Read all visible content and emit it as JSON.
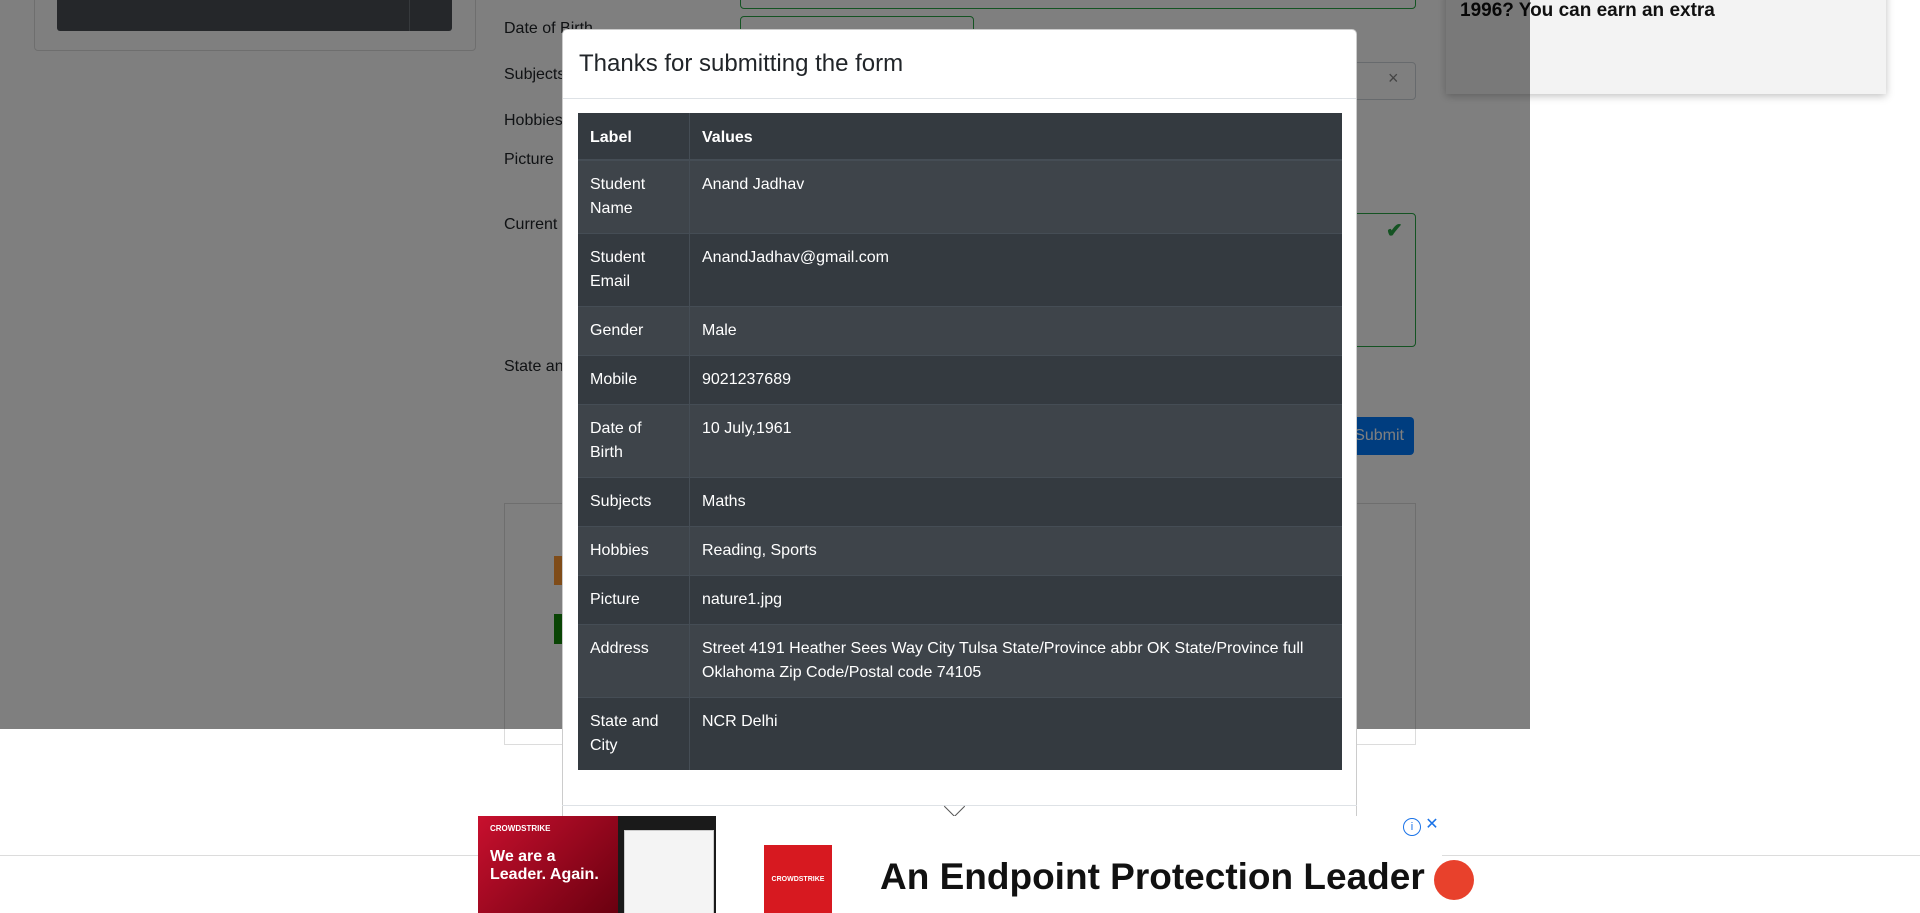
{
  "background_form": {
    "labels": {
      "date_of_birth": "Date of Birth",
      "subjects": "Subjects",
      "hobbies": "Hobbies",
      "picture": "Picture",
      "current_address": "Current",
      "state_and_city": "State and"
    },
    "submit_label": "Submit",
    "clear_icon": "×",
    "check_icon": "✔"
  },
  "top_ad": {
    "text": "1996? You can earn an extra"
  },
  "modal": {
    "title": "Thanks for submitting the form",
    "table": {
      "headers": [
        "Label",
        "Values"
      ],
      "rows": [
        {
          "label": "Student Name",
          "value": "Anand Jadhav"
        },
        {
          "label": "Student Email",
          "value": "AnandJadhav@gmail.com"
        },
        {
          "label": "Gender",
          "value": "Male"
        },
        {
          "label": "Mobile",
          "value": "9021237689"
        },
        {
          "label": "Date of Birth",
          "value": "10 July,1961"
        },
        {
          "label": "Subjects",
          "value": "Maths"
        },
        {
          "label": "Hobbies",
          "value": "Reading, Sports"
        },
        {
          "label": "Picture",
          "value": "nature1.jpg"
        },
        {
          "label": "Address",
          "value": "Street 4191 Heather Sees Way City Tulsa State/Province abbr OK State/Province full Oklahoma Zip Code/Postal code 74105"
        },
        {
          "label": "State and City",
          "value": "NCR Delhi"
        }
      ]
    }
  },
  "bottom_ad": {
    "brand": "CROWDSTRIKE",
    "tagline": "We are a Leader. Again.",
    "logo_text": "CROWDSTRIKE",
    "headline": "An Endpoint Protection Leader",
    "info_icon": "i",
    "close_icon": "✕"
  }
}
